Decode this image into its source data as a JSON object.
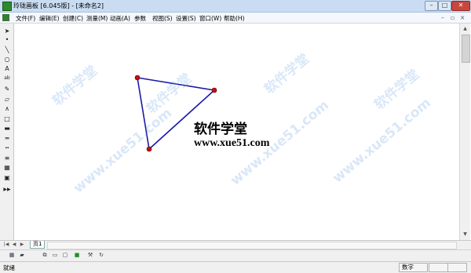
{
  "window": {
    "title": "玲珑画板 [6.045版] - [未命名2]",
    "minimize": "–",
    "maximize": "□",
    "close": "✕"
  },
  "menu": [
    {
      "label": "文件(F)"
    },
    {
      "label": "编辑(E)"
    },
    {
      "label": "创建(C)"
    },
    {
      "label": "测量(M)"
    },
    {
      "label": "动画(A)"
    },
    {
      "label": "参数"
    },
    {
      "label": "视图(S)"
    },
    {
      "label": "设置(S)"
    },
    {
      "label": "窗口(W)"
    },
    {
      "label": "帮助(H)"
    }
  ],
  "tools": [
    {
      "name": "select-arrow-icon",
      "glyph": "➤"
    },
    {
      "name": "point-tool-icon",
      "glyph": "•"
    },
    {
      "name": "line-tool-icon",
      "glyph": "╲"
    },
    {
      "name": "circle-tool-icon",
      "glyph": "○"
    },
    {
      "name": "text-tool-A-icon",
      "glyph": "A"
    },
    {
      "name": "text-tool-ab-icon",
      "glyph": "ab"
    },
    {
      "name": "pencil-tool-icon",
      "glyph": "✎"
    },
    {
      "name": "eraser-tool-icon",
      "glyph": "▱"
    },
    {
      "name": "polyline-tool-icon",
      "glyph": "∧"
    },
    {
      "name": "rectangle-tool-icon",
      "glyph": "□"
    },
    {
      "name": "thick-line-icon",
      "glyph": "▬"
    },
    {
      "name": "thin-line-icon",
      "glyph": "═"
    },
    {
      "name": "dashed-line-icon",
      "glyph": "┅"
    },
    {
      "name": "multi-line-icon",
      "glyph": "≡"
    },
    {
      "name": "color-palette-icon",
      "glyph": "▦"
    },
    {
      "name": "image-tool-icon",
      "glyph": "▣"
    },
    {
      "name": "fast-forward-icon",
      "glyph": "▶▶"
    }
  ],
  "canvas": {
    "text_cn": "软件学堂",
    "text_url": "www.xue51.com",
    "watermark": "软件学堂",
    "watermark_url": "www.xue51.com"
  },
  "tabs": {
    "page_tab": "页1"
  },
  "bottom_icons": [
    {
      "name": "grid-view-icon",
      "glyph": "▦"
    },
    {
      "name": "layer-icon",
      "glyph": "▰"
    },
    {
      "name": "page-copy-icon",
      "glyph": "⧉"
    },
    {
      "name": "page-stack-icon",
      "glyph": "▭"
    },
    {
      "name": "page-add-icon",
      "glyph": "▢"
    },
    {
      "name": "green-square-icon",
      "glyph": "■"
    },
    {
      "name": "tools-icon",
      "glyph": "⚒"
    },
    {
      "name": "refresh-icon",
      "glyph": "↻"
    }
  ],
  "status": {
    "ready": "就绪",
    "numlock": "数字"
  },
  "colors": {
    "line": "#1a1aa8",
    "vertex": "#c01010"
  }
}
